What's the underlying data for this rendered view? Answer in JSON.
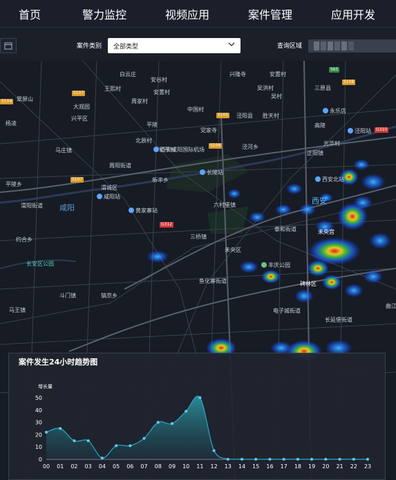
{
  "nav": {
    "items": [
      "首页",
      "警力监控",
      "视频应用",
      "案件管理",
      "应用开发"
    ]
  },
  "filters": {
    "category_label": "案件类别",
    "category_value": "全部类型",
    "region_label": "查询区域"
  },
  "map": {
    "area_labels": [
      "白云庄",
      "兴隆寺",
      "安置村",
      "安谷村",
      "吴洪村",
      "翠屏山",
      "王熙村",
      "安置村",
      "吴村",
      "三原县",
      "大观园",
      "兴平区",
      "周家村",
      "中国村",
      "泾阳县",
      "胜天村",
      "党家寺",
      "杨凌",
      "平陵",
      "北辰村",
      "西安咸阳国际机场",
      "永乐店",
      "高陵",
      "泾河乡",
      "光华村",
      "马庄镇",
      "和平村",
      "正阳镇",
      "周阳街道",
      "新丰乡",
      "平陵乡",
      "渭城区",
      "咸阳站",
      "长陵站",
      "西安北站",
      "西安",
      "咸阳",
      "渭阳街道",
      "六村堡镇",
      "黄家寨站",
      "周陵镇",
      "三桥镇",
      "泰和街道",
      "未央区",
      "未央宫",
      "约合乡",
      "长安区公园",
      "五凤村",
      "鱼化寨街道",
      "丰庆公园",
      "碑林区",
      "斗门镇",
      "镐京乡",
      "电子城街道",
      "长延堡街道",
      "马王镇",
      "曲江"
    ],
    "road_shields": [
      "S107",
      "S104",
      "S105",
      "S108",
      "S106",
      "S107",
      "S301",
      "S104",
      "S108",
      "G312",
      "G70",
      "G310",
      "S65"
    ],
    "pois": [
      "西安咸阳国际机场",
      "咸阳站",
      "长陵站",
      "西安北站",
      "黄家寨站",
      "丰庆公园",
      "永乐店",
      "泾阳站"
    ]
  },
  "chart_panel": {
    "title": "案件发生24小时趋势图",
    "chart_data": {
      "type": "area",
      "title": "案件发生24小时趋势图",
      "ylabel": "增长量",
      "ylim": [
        0,
        50
      ],
      "yticks": [
        0,
        10,
        20,
        30,
        40,
        50
      ],
      "categories": [
        "00",
        "01",
        "02",
        "03",
        "04",
        "05",
        "06",
        "07",
        "08",
        "09",
        "10",
        "11",
        "12",
        "13",
        "14",
        "15",
        "16",
        "17",
        "18",
        "19",
        "20",
        "21",
        "22",
        "23"
      ],
      "values": [
        22,
        25,
        15,
        15,
        1,
        11,
        11,
        17,
        30,
        29,
        39,
        50,
        7,
        0,
        0,
        0,
        0,
        0,
        0,
        0,
        0,
        0,
        0,
        0
      ],
      "colors": {
        "line": "#2aa7c9",
        "fill_top": "#2a8f9c",
        "fill_bottom": "#1c3340"
      }
    }
  }
}
